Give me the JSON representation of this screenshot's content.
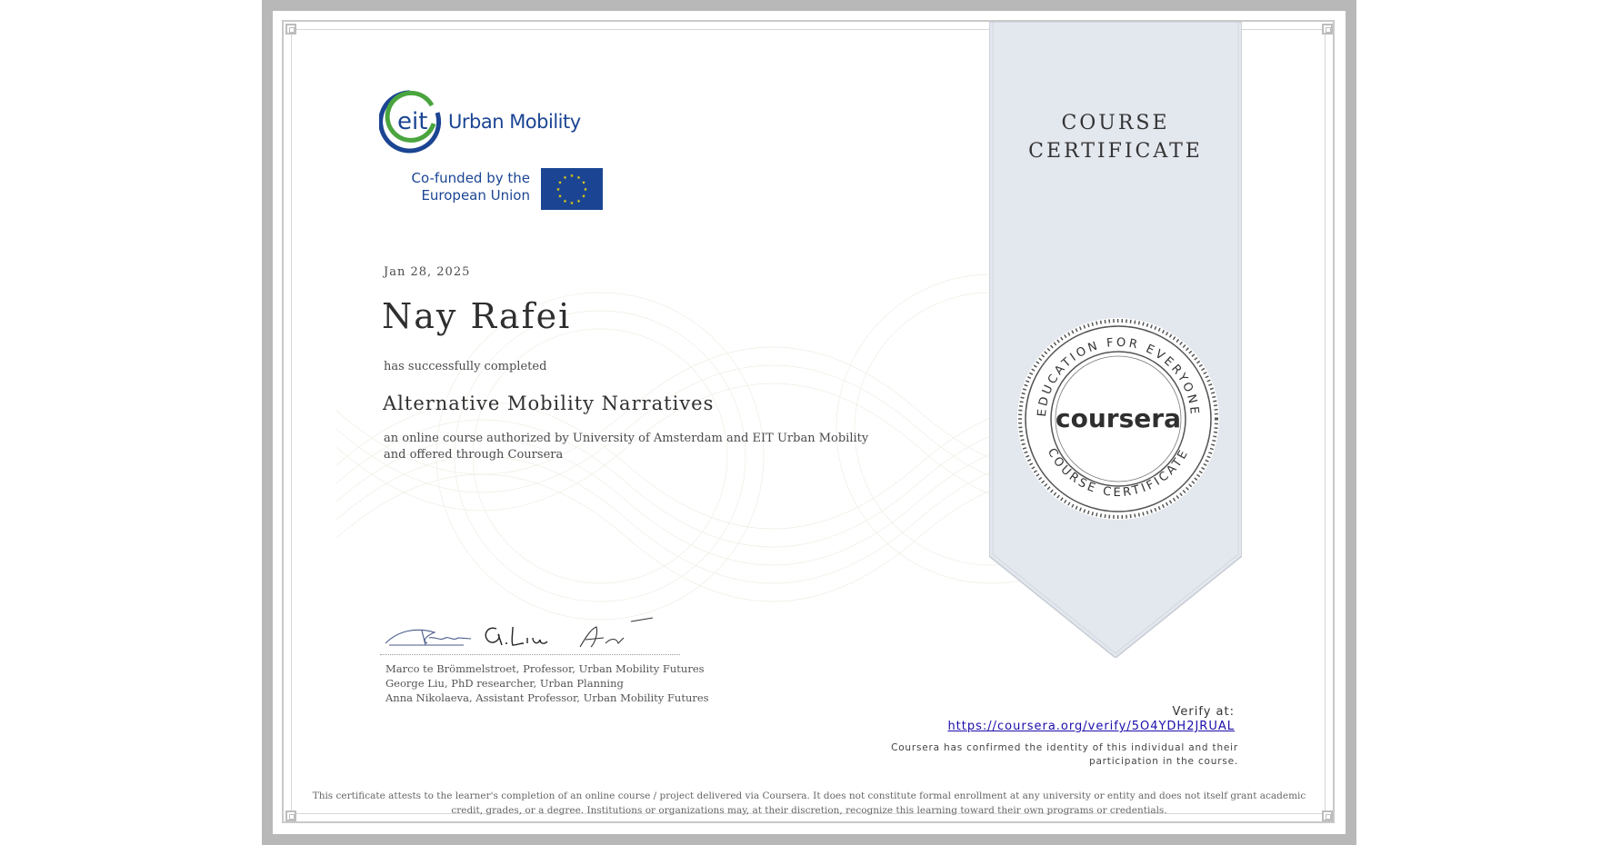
{
  "ribbon": {
    "title": "COURSE\nCERTIFICATE"
  },
  "logo": {
    "eit_text": "eit",
    "org_text": "Urban Mobility",
    "eu_text": "Co-funded by the\nEuropean Union"
  },
  "certificate": {
    "date": "Jan 28, 2025",
    "recipient": "Nay Rafei",
    "completed_text": "has successfully completed",
    "course_title": "Alternative Mobility Narratives",
    "description": "an online course authorized by University of Amsterdam and EIT Urban Mobility and offered through Coursera"
  },
  "signers": [
    "Marco te Brömmelstroet, Professor, Urban Mobility Futures",
    "George Liu, PhD researcher, Urban Planning",
    "Anna Nikolaeva, Assistant Professor, Urban Mobility Futures"
  ],
  "seal": {
    "ring_top": "EDUCATION FOR EVERYONE",
    "ring_bottom": "COURSE CERTIFICATE",
    "brand": "coursera"
  },
  "verify": {
    "label": "Verify at:",
    "url": "https://coursera.org/verify/5O4YDH2JRUAL",
    "note": "Coursera has confirmed the identity of this individual and their participation in the course."
  },
  "disclaimer": "This certificate attests to the learner's completion of an online course / project delivered via Coursera. It does not constitute formal enrollment at any university or entity and does not itself grant academic credit, grades, or a degree. Institutions or organizations may, at their discretion, recognize this learning toward their own programs or credentials.",
  "colors": {
    "eit_blue": "#1b4593",
    "eit_green": "#4aa53f",
    "eu_flag": "#1b4593",
    "eu_star": "#ffdd00",
    "ribbon": "#e3e7ee",
    "link": "#1a0dab"
  }
}
